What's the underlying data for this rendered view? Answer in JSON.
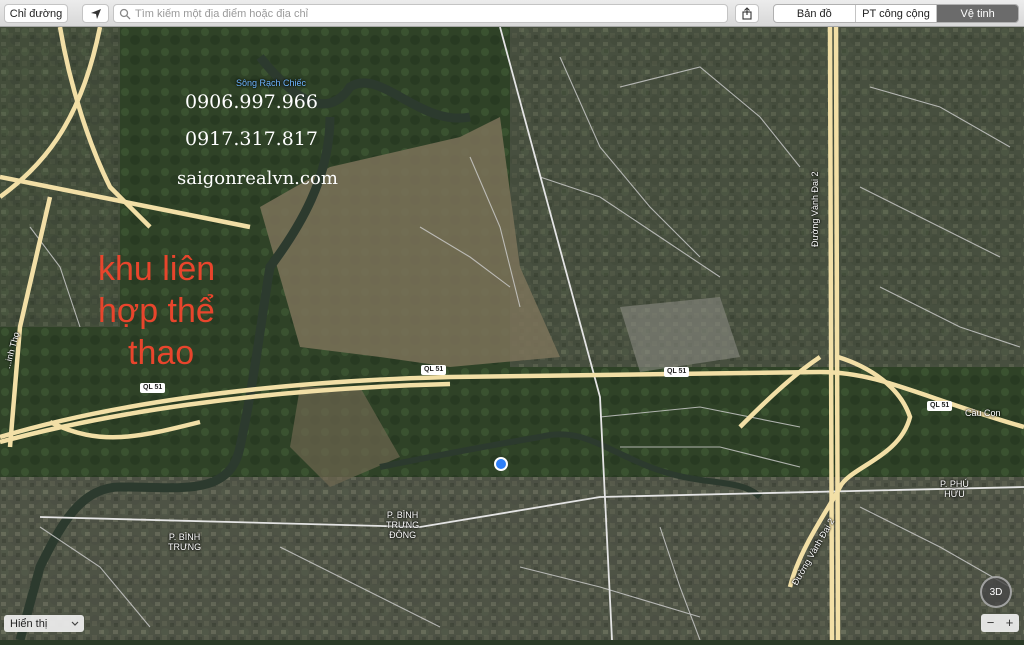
{
  "toolbar": {
    "directions_label": "Chỉ đường",
    "search_placeholder": "Tìm kiếm một địa điểm hoặc địa chỉ",
    "map_types": [
      "Bản đồ",
      "PT công cộng",
      "Vệ tinh"
    ],
    "active_map_type": "Vệ tinh"
  },
  "overlay": {
    "phone1": "0906.997.966",
    "phone2": "0917.317.817",
    "website": "saigonrealvn.com",
    "red_line1": "khu liên",
    "red_line2": "hợp thể",
    "red_line3": "thao"
  },
  "map_labels": {
    "river": "Sông Rạch Chiếc",
    "binh_trung_a": "P. BÌNH",
    "binh_trung_b": "TRƯNG",
    "binh_trung_dong_a": "P. BÌNH",
    "binh_trung_dong_b": "TRƯNG",
    "binh_trung_dong_c": "ĐÔNG",
    "phu_huu_a": "P. PHÚ",
    "phu_huu_b": "HỮU",
    "cau_con": "Cầu Cọn",
    "vanh_dai_north": "Đường Vành Đai 2",
    "vanh_dai_south": "Đường Vành Đai 2",
    "left_road": "...inh Thọ",
    "ql51_1": "QL 51",
    "ql51_2": "QL 51",
    "ql51_3": "QL 51",
    "ql51_4": "QL 51"
  },
  "controls": {
    "display_label": "Hiển thị",
    "btn_3d": "3D",
    "zoom_out": "−",
    "zoom_in": "+"
  },
  "colors": {
    "highway": "#f2dfa6",
    "road": "#d9d9d9",
    "accent_red": "#e8452c",
    "location_blue": "#2d7ff9"
  }
}
